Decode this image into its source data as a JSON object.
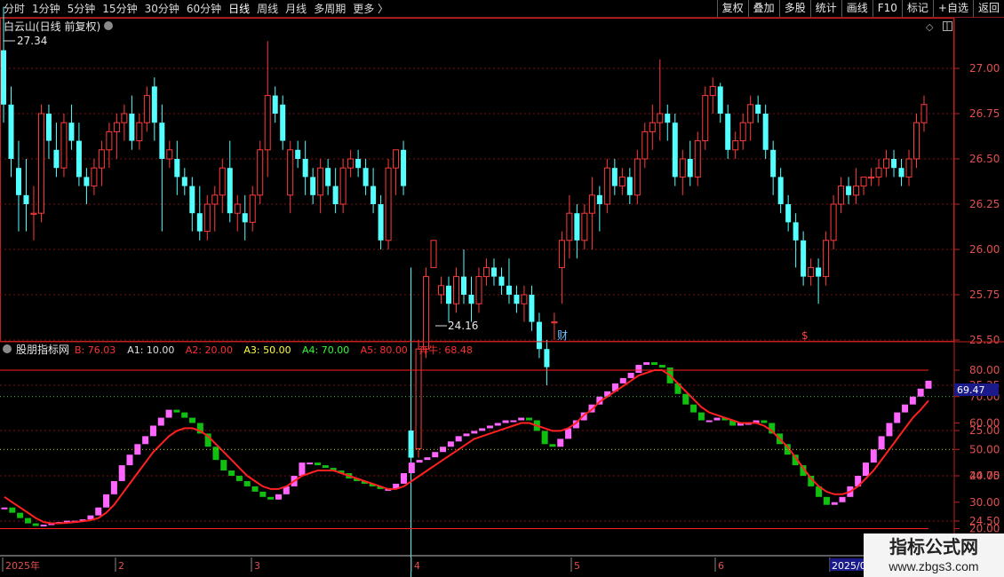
{
  "toolbar": {
    "left": [
      "分时",
      "1分钟",
      "5分钟",
      "15分钟",
      "30分钟",
      "60分钟",
      "日线",
      "周线",
      "月线",
      "多周期",
      "更多 〉"
    ],
    "active": "日线",
    "right": [
      "复权",
      "叠加",
      "多股",
      "统计",
      "画线",
      "F10",
      "标记",
      "+自选",
      "返回"
    ]
  },
  "main": {
    "stock_title": "白云山(日线 前复权)",
    "high_label": "27.34",
    "low_label": "24.16",
    "y_ticks": [
      "27.00",
      "26.75",
      "26.50",
      "26.25",
      "26.00",
      "25.75",
      "25.50",
      "25.25",
      "25.00",
      "24.75",
      "24.50"
    ],
    "event_markers": [
      "财",
      "$"
    ]
  },
  "indicator": {
    "name": "股朋指标网",
    "values": [
      {
        "label": "B: 76.03",
        "color": "#ff3030"
      },
      {
        "label": "A1: 10.00",
        "color": "#e0e0e0"
      },
      {
        "label": "A2: 20.00",
        "color": "#ff3030"
      },
      {
        "label": "A3: 50.00",
        "color": "#ffff40"
      },
      {
        "label": "A4: 70.00",
        "color": "#30ff30"
      },
      {
        "label": "A5: 80.00",
        "color": "#ff3030"
      },
      {
        "label": "奔牛: 68.48",
        "color": "#ff3030"
      }
    ],
    "y_ticks": [
      "80.00",
      "70.00",
      "60.00",
      "50.00",
      "40.00",
      "30.00",
      "20.00"
    ],
    "current_value": "69.47"
  },
  "time_axis": [
    "2025年",
    "2",
    "3",
    "4",
    "5",
    "6",
    "2025/0"
  ],
  "watermark": {
    "title": "指标公式网",
    "url": "www.zbgs3.com"
  },
  "colors": {
    "up": "#ff3b3b",
    "down": "#54ffff",
    "bull": "#ff66ff",
    "bear": "#10c010",
    "line": "#ff2020",
    "grid": "#7a1010",
    "accent": "#c02020"
  },
  "chart_data": [
    {
      "type": "candlestick",
      "title": "白云山(日线 前复权)",
      "ylim": [
        24.16,
        27.34
      ],
      "candles_ohlc": [
        [
          27.1,
          27.34,
          26.7,
          26.8
        ],
        [
          26.8,
          26.9,
          26.4,
          26.5
        ],
        [
          26.45,
          26.6,
          26.1,
          26.3
        ],
        [
          26.3,
          26.5,
          26.1,
          26.25
        ],
        [
          26.2,
          26.35,
          26.05,
          26.2
        ],
        [
          26.2,
          26.8,
          26.15,
          26.75
        ],
        [
          26.75,
          26.8,
          26.5,
          26.6
        ],
        [
          26.55,
          26.7,
          26.4,
          26.45
        ],
        [
          26.45,
          26.75,
          26.4,
          26.7
        ],
        [
          26.7,
          26.8,
          26.55,
          26.6
        ],
        [
          26.6,
          26.7,
          26.35,
          26.4
        ],
        [
          26.4,
          26.45,
          26.25,
          26.35
        ],
        [
          26.35,
          26.5,
          26.3,
          26.45
        ],
        [
          26.45,
          26.6,
          26.35,
          26.55
        ],
        [
          26.55,
          26.7,
          26.45,
          26.65
        ],
        [
          26.65,
          26.75,
          26.5,
          26.7
        ],
        [
          26.7,
          26.8,
          26.6,
          26.75
        ],
        [
          26.75,
          26.85,
          26.55,
          26.6
        ],
        [
          26.6,
          26.75,
          26.55,
          26.7
        ],
        [
          26.7,
          26.9,
          26.65,
          26.85
        ],
        [
          26.9,
          26.95,
          26.6,
          26.7
        ],
        [
          26.7,
          26.8,
          26.1,
          26.5
        ],
        [
          26.5,
          26.6,
          26.45,
          26.55
        ],
        [
          26.5,
          26.6,
          26.3,
          26.4
        ],
        [
          26.4,
          26.45,
          26.3,
          26.35
        ],
        [
          26.35,
          26.4,
          26.1,
          26.2
        ],
        [
          26.2,
          26.35,
          26.05,
          26.1
        ],
        [
          26.1,
          26.3,
          26.05,
          26.25
        ],
        [
          26.25,
          26.35,
          26.1,
          26.3
        ],
        [
          26.3,
          26.5,
          26.2,
          26.45
        ],
        [
          26.45,
          26.6,
          26.15,
          26.2
        ],
        [
          26.2,
          26.3,
          26.1,
          26.25
        ],
        [
          26.2,
          26.3,
          26.05,
          26.15
        ],
        [
          26.15,
          26.35,
          26.1,
          26.3
        ],
        [
          26.3,
          26.6,
          26.25,
          26.55
        ],
        [
          26.55,
          27.15,
          26.4,
          26.85
        ],
        [
          26.85,
          26.9,
          26.7,
          26.75
        ],
        [
          26.8,
          26.85,
          26.55,
          26.6
        ],
        [
          26.3,
          26.6,
          26.2,
          26.55
        ],
        [
          26.55,
          26.6,
          26.45,
          26.5
        ],
        [
          26.5,
          26.6,
          26.3,
          26.4
        ],
        [
          26.4,
          26.45,
          26.25,
          26.3
        ],
        [
          26.3,
          26.5,
          26.2,
          26.45
        ],
        [
          26.45,
          26.5,
          26.3,
          26.35
        ],
        [
          26.35,
          26.45,
          26.2,
          26.25
        ],
        [
          26.25,
          26.5,
          26.2,
          26.45
        ],
        [
          26.45,
          26.55,
          26.4,
          26.5
        ],
        [
          26.5,
          26.55,
          26.4,
          26.45
        ],
        [
          26.45,
          26.5,
          26.3,
          26.35
        ],
        [
          26.35,
          26.45,
          26.2,
          26.25
        ],
        [
          26.25,
          26.3,
          26.0,
          26.05
        ],
        [
          26.05,
          26.5,
          26.0,
          26.45
        ],
        [
          26.45,
          26.55,
          26.3,
          26.55
        ],
        [
          26.55,
          26.6,
          26.3,
          26.35
        ],
        [
          25.0,
          25.9,
          24.16,
          24.85
        ],
        [
          24.9,
          25.5,
          24.85,
          25.45
        ],
        [
          25.45,
          25.9,
          25.4,
          25.85
        ],
        [
          25.9,
          26.0,
          25.9,
          26.05
        ],
        [
          25.75,
          25.85,
          25.7,
          25.8
        ],
        [
          25.8,
          25.85,
          25.6,
          25.7
        ],
        [
          25.7,
          25.9,
          25.65,
          25.85
        ],
        [
          25.85,
          26.0,
          25.7,
          25.75
        ],
        [
          25.75,
          25.85,
          25.6,
          25.7
        ],
        [
          25.7,
          25.9,
          25.65,
          25.85
        ],
        [
          25.85,
          25.95,
          25.8,
          25.9
        ],
        [
          25.9,
          25.95,
          25.8,
          25.85
        ],
        [
          25.85,
          25.9,
          25.75,
          25.8
        ],
        [
          25.8,
          25.95,
          25.7,
          25.75
        ],
        [
          25.75,
          25.8,
          25.65,
          25.7
        ],
        [
          25.7,
          25.8,
          25.6,
          25.75
        ],
        [
          25.75,
          25.8,
          25.55,
          25.6
        ],
        [
          25.6,
          25.65,
          25.4,
          25.45
        ],
        [
          25.45,
          25.5,
          25.25,
          25.35
        ],
        [
          25.6,
          25.65,
          25.5,
          25.6
        ],
        [
          25.9,
          26.1,
          25.7,
          26.05
        ],
        [
          26.05,
          26.3,
          25.95,
          26.2
        ],
        [
          26.2,
          26.25,
          25.95,
          26.05
        ],
        [
          26.05,
          26.25,
          26.0,
          26.2
        ],
        [
          26.2,
          26.4,
          26.0,
          26.3
        ],
        [
          26.3,
          26.35,
          26.1,
          26.25
        ],
        [
          26.25,
          26.5,
          26.2,
          26.45
        ],
        [
          26.45,
          26.5,
          26.3,
          26.35
        ],
        [
          26.35,
          26.45,
          26.3,
          26.4
        ],
        [
          26.4,
          26.45,
          26.25,
          26.3
        ],
        [
          26.3,
          26.55,
          26.25,
          26.5
        ],
        [
          26.5,
          26.7,
          26.45,
          26.65
        ],
        [
          26.65,
          26.8,
          26.55,
          26.7
        ],
        [
          26.7,
          27.05,
          26.6,
          26.75
        ],
        [
          26.75,
          26.8,
          26.6,
          26.7
        ],
        [
          26.7,
          26.75,
          26.35,
          26.4
        ],
        [
          26.4,
          26.55,
          26.3,
          26.5
        ],
        [
          26.5,
          26.6,
          26.35,
          26.4
        ],
        [
          26.4,
          26.65,
          26.35,
          26.6
        ],
        [
          26.6,
          26.9,
          26.55,
          26.85
        ],
        [
          26.85,
          26.95,
          26.75,
          26.9
        ],
        [
          26.9,
          26.92,
          26.7,
          26.75
        ],
        [
          26.75,
          26.8,
          26.5,
          26.55
        ],
        [
          26.55,
          26.65,
          26.5,
          26.6
        ],
        [
          26.6,
          26.75,
          26.55,
          26.7
        ],
        [
          26.7,
          26.85,
          26.6,
          26.8
        ],
        [
          26.8,
          26.85,
          26.7,
          26.75
        ],
        [
          26.75,
          26.8,
          26.5,
          26.55
        ],
        [
          26.55,
          26.6,
          26.3,
          26.4
        ],
        [
          26.4,
          26.45,
          26.2,
          26.25
        ],
        [
          26.25,
          26.3,
          26.1,
          26.15
        ],
        [
          26.15,
          26.2,
          25.9,
          26.05
        ],
        [
          26.05,
          26.1,
          25.8,
          25.85
        ],
        [
          25.85,
          25.95,
          25.8,
          25.9
        ],
        [
          25.9,
          25.95,
          25.7,
          25.85
        ],
        [
          25.85,
          26.1,
          25.8,
          26.05
        ],
        [
          26.05,
          26.3,
          26.0,
          26.25
        ],
        [
          26.25,
          26.4,
          26.2,
          26.35
        ],
        [
          26.35,
          26.4,
          26.25,
          26.3
        ],
        [
          26.3,
          26.45,
          26.25,
          26.35
        ],
        [
          26.35,
          26.4,
          26.3,
          26.4
        ],
        [
          26.4,
          26.45,
          26.35,
          26.4
        ],
        [
          26.4,
          26.5,
          26.35,
          26.45
        ],
        [
          26.45,
          26.55,
          26.4,
          26.5
        ],
        [
          26.5,
          26.55,
          26.4,
          26.45
        ],
        [
          26.45,
          26.5,
          26.35,
          26.4
        ],
        [
          26.4,
          26.55,
          26.35,
          26.5
        ],
        [
          26.5,
          26.75,
          26.45,
          26.7
        ],
        [
          26.7,
          26.85,
          26.65,
          26.8
        ]
      ],
      "price_labels": {
        "high": 27.34,
        "low": 24.16
      }
    },
    {
      "type": "line",
      "title": "股朋指标网",
      "ylim": [
        18,
        86
      ],
      "y_ticks": [
        80,
        70,
        60,
        50,
        40,
        30,
        20
      ],
      "reference_lines": [
        {
          "name": "A1",
          "value": 10
        },
        {
          "name": "A2",
          "value": 20
        },
        {
          "name": "A3",
          "value": 50
        },
        {
          "name": "A4",
          "value": 70
        },
        {
          "name": "A5",
          "value": 80
        }
      ],
      "series": [
        {
          "name": "B",
          "values": [
            28,
            26,
            24,
            22,
            21,
            21.5,
            22,
            22.5,
            23,
            23,
            23.5,
            25,
            28,
            33,
            38,
            44,
            48,
            52,
            55,
            59,
            62,
            65,
            64,
            62,
            60,
            56,
            51,
            46,
            42,
            40,
            38,
            36,
            34,
            32,
            31,
            33,
            36,
            40,
            45,
            45,
            44,
            43,
            42,
            41,
            39,
            38,
            37,
            36,
            35,
            35,
            37,
            41,
            45,
            46,
            47,
            49,
            51,
            53,
            55,
            56,
            57,
            58,
            59,
            60,
            61,
            61,
            62,
            61,
            57,
            52,
            51,
            54,
            58,
            61,
            64,
            67,
            70,
            72,
            75,
            77,
            79,
            82,
            83,
            82,
            81,
            75,
            71,
            67,
            64,
            61,
            61,
            62,
            61,
            59,
            60,
            60,
            61,
            60,
            56,
            52,
            48,
            44,
            40,
            36,
            32,
            29,
            30,
            32,
            36,
            40,
            45,
            50,
            55,
            60,
            64,
            67,
            70,
            73,
            76
          ]
        },
        {
          "name": "奔牛",
          "values": [
            32,
            30,
            28,
            26,
            24,
            22.5,
            22,
            22,
            22.2,
            22.5,
            22.8,
            23.2,
            24,
            26,
            29,
            33,
            37,
            41,
            45,
            49,
            52,
            55,
            57,
            58,
            58,
            57,
            55,
            52,
            49,
            46,
            43,
            40,
            38,
            36,
            35,
            35,
            36,
            38,
            40,
            41,
            42,
            42,
            42,
            41,
            40,
            39,
            38,
            37,
            36,
            35,
            35,
            36,
            38,
            40,
            42,
            44,
            46,
            48,
            50,
            52,
            54,
            55,
            56,
            57,
            58,
            59,
            60,
            60,
            59,
            58,
            57,
            57,
            58,
            60,
            63,
            65,
            68,
            70,
            72,
            74,
            76,
            78,
            79,
            80,
            80,
            78,
            75,
            72,
            69,
            66,
            64,
            63,
            62,
            61,
            60,
            60,
            60,
            59,
            57,
            54,
            51,
            47,
            43,
            39,
            36,
            34,
            33,
            33,
            34,
            36,
            39,
            42,
            46,
            50,
            54,
            58,
            62,
            65,
            68.48
          ]
        }
      ]
    }
  ]
}
